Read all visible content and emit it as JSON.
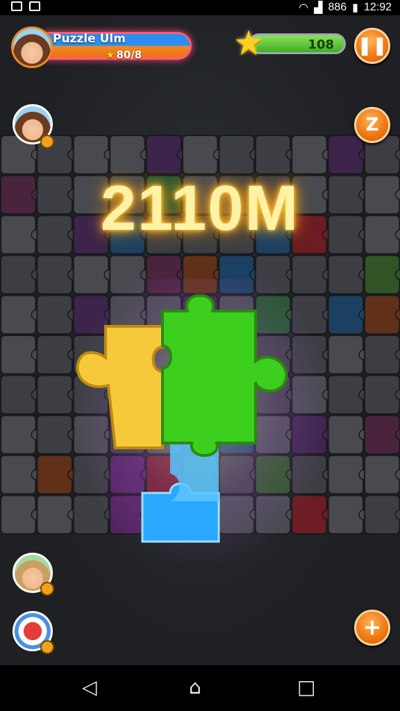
{
  "status_bar": {
    "signal_text": "886",
    "time": "12:92"
  },
  "player": {
    "name": "Puzzle Ulm",
    "stars": "80/8"
  },
  "energy": {
    "value": "108"
  },
  "score": "2110M",
  "colors": {
    "tile_palette": [
      "#4a4d52",
      "#5a5d62",
      "#2e6b3a",
      "#8a1f26",
      "#4a2a5c",
      "#6a2a7a",
      "#1f4f7a",
      "#3a6a2a",
      "#7a3a18",
      "#5c2a4a"
    ],
    "piece_yellow": "#f6c93a",
    "piece_green": "#3ccf1e",
    "piece_blue": "#2aa7ff",
    "accent_orange": "#f07a14"
  },
  "buttons": {
    "pause_icon": "pause-icon",
    "hint_icon": "z-hint-icon",
    "add_icon": "plus-icon"
  },
  "nav": {
    "back_icon": "back-triangle-icon",
    "home_icon": "home-icon",
    "recent_icon": "recent-square-icon"
  }
}
